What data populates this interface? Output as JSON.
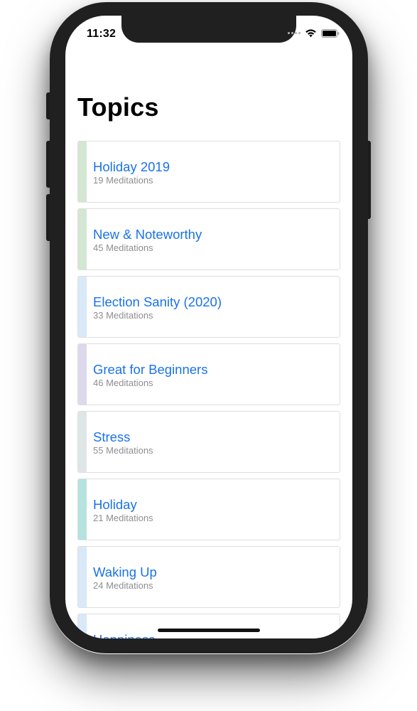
{
  "status_bar": {
    "time": "11:32",
    "icons": [
      "signal-dots-icon",
      "wifi-icon",
      "battery-icon"
    ]
  },
  "page": {
    "title": "Topics"
  },
  "topics": [
    {
      "title": "Holiday 2019",
      "subtitle": "19 Meditations",
      "accent": "#d3e7d3"
    },
    {
      "title": "New & Noteworthy",
      "subtitle": "45 Meditations",
      "accent": "#d3e7d3"
    },
    {
      "title": "Election Sanity (2020)",
      "subtitle": "33 Meditations",
      "accent": "#d9e9f8"
    },
    {
      "title": "Great for Beginners",
      "subtitle": "46 Meditations",
      "accent": "#ddd9ec"
    },
    {
      "title": "Stress",
      "subtitle": "55 Meditations",
      "accent": "#dfe6e6"
    },
    {
      "title": "Holiday",
      "subtitle": "21 Meditations",
      "accent": "#b6e2e0"
    },
    {
      "title": "Waking Up",
      "subtitle": "24 Meditations",
      "accent": "#d9e9f8"
    },
    {
      "title": "Happiness",
      "subtitle": "",
      "accent": "#d9e9f8"
    }
  ],
  "colors": {
    "link_blue": "#1a73e8",
    "subtitle_gray": "#8e8e93",
    "phone_frame": "#202020"
  }
}
